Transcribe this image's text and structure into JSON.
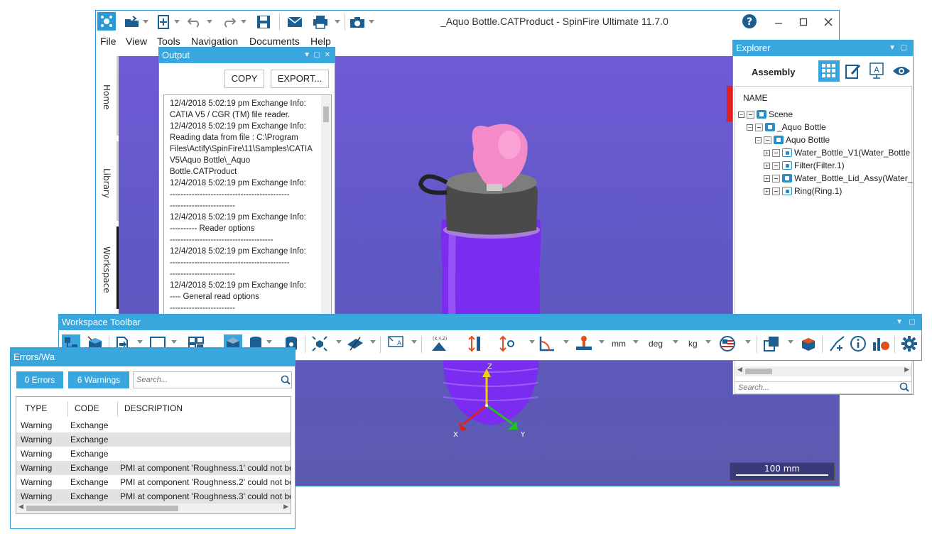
{
  "window": {
    "title": "_Aquo Bottle.CATProduct - SpinFire Ultimate 11.7.0",
    "menu": [
      "File",
      "View",
      "Tools",
      "Navigation",
      "Documents",
      "Help"
    ],
    "side_tabs": [
      "Home",
      "Library",
      "Workspace"
    ]
  },
  "output_panel": {
    "title": "Output",
    "copy_label": "COPY",
    "export_label": "EXPORT...",
    "lines": [
      "12/4/2018 5:02:19 pm Exchange Info:",
      "CATIA V5 / CGR (TM) file reader.",
      "12/4/2018 5:02:19 pm Exchange Info:",
      "Reading data from file  : C:\\Program",
      "Files\\Actify\\SpinFire\\11\\Samples\\CATIA",
      "V5\\Aquo Bottle\\_Aquo",
      "Bottle.CATProduct",
      "12/4/2018 5:02:19 pm Exchange Info:",
      "--------------------------------------------",
      "------------------------",
      "12/4/2018 5:02:19 pm Exchange Info:",
      "---------- Reader options",
      "--------------------------------------",
      "12/4/2018 5:02:19 pm Exchange Info:",
      "--------------------------------------------",
      "------------------------",
      "12/4/2018 5:02:19 pm Exchange Info:",
      "---- General read options",
      "------------------------"
    ]
  },
  "explorer": {
    "title": "Explorer",
    "tab_label": "Assembly",
    "column_header": "NAME",
    "tree": [
      "Scene",
      "_Aquo Bottle",
      "Aquo Bottle",
      "Water_Bottle_V1(Water_Bottle",
      "Filter(Filter.1)",
      "Water_Bottle_Lid_Assy(Water_",
      "Ring(Ring.1)"
    ],
    "search_placeholder": "Search..."
  },
  "workspace_toolbar": {
    "title": "Workspace Toolbar",
    "unit_length": "mm",
    "unit_angle": "deg",
    "unit_mass": "kg"
  },
  "errors_panel": {
    "title": "Errors/Wa",
    "errors_label": "0 Errors",
    "warnings_label": "6 Warnings",
    "search_placeholder": "Search...",
    "columns": [
      "TYPE",
      "CODE",
      "DESCRIPTION"
    ],
    "rows": [
      [
        "Warning",
        "Exchange",
        ""
      ],
      [
        "Warning",
        "Exchange",
        ""
      ],
      [
        "Warning",
        "Exchange",
        ""
      ],
      [
        "Warning",
        "Exchange",
        "PMI at component 'Roughness.1' could not be"
      ],
      [
        "Warning",
        "Exchange",
        "PMI at component 'Roughness.2' could not be"
      ],
      [
        "Warning",
        "Exchange",
        "PMI at component 'Roughness.3' could not be"
      ]
    ]
  },
  "viewport": {
    "axis_x": "X",
    "axis_y": "Y",
    "axis_z": "Z",
    "scale_label": "100 mm"
  },
  "colors": {
    "accent": "#3aa6de",
    "viewport": "#6a5ad0",
    "bottle": "#7a2cf0",
    "cap": "#4a4a4a",
    "mouthpiece": "#f58ac9"
  }
}
